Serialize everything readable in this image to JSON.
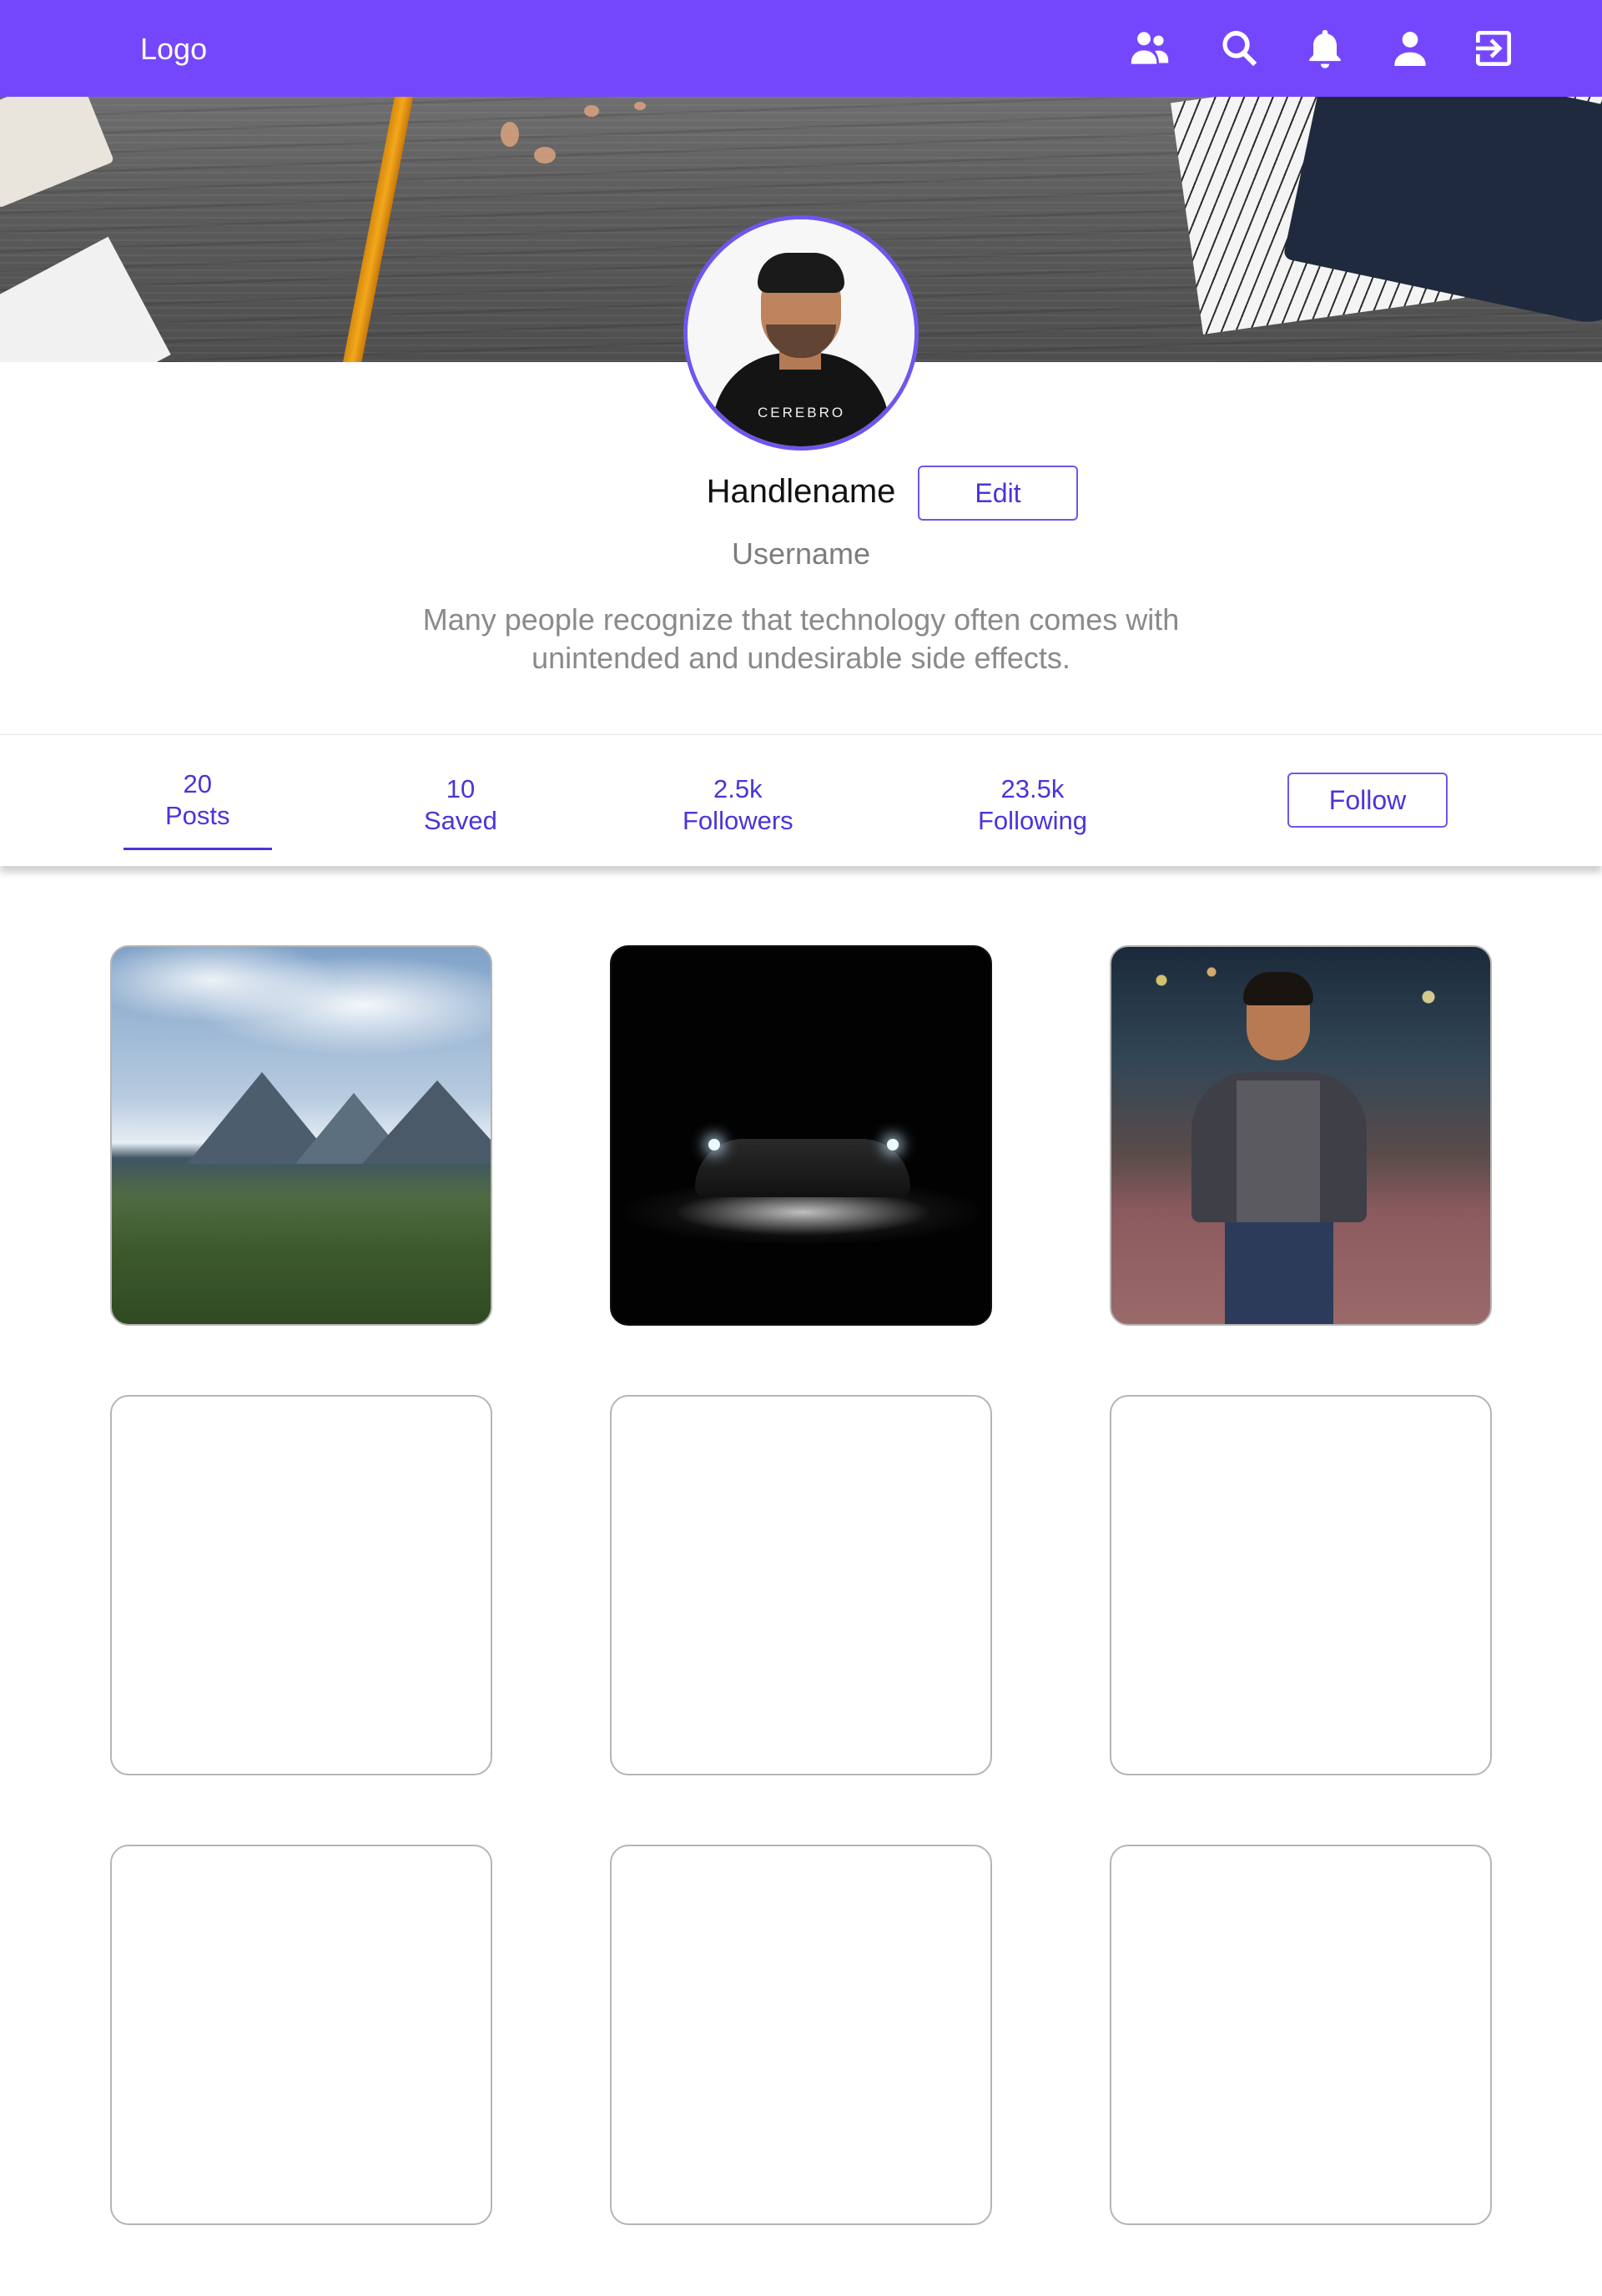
{
  "navbar": {
    "logo": "Logo",
    "background": "#7547fc",
    "icons": [
      "people-icon",
      "search-icon",
      "bell-icon",
      "profile-icon",
      "logout-icon"
    ]
  },
  "profile": {
    "handlename": "Handlename",
    "edit_label": "Edit",
    "username": "Username",
    "bio": "Many people recognize that technology often comes with unintended and undesirable side effects.",
    "avatar_tee_text": "CEREBRO"
  },
  "stats": {
    "posts": {
      "count": "20",
      "label": "Posts"
    },
    "saved": {
      "count": "10",
      "label": "Saved"
    },
    "followers": {
      "count": "2.5k",
      "label": "Followers"
    },
    "following": {
      "count": "23.5k",
      "label": "Following"
    },
    "follow_label": "Follow",
    "active_tab": "posts"
  },
  "grid": {
    "posts": [
      {
        "content": "mountain landscape photo"
      },
      {
        "content": "dark car with headlights photo"
      },
      {
        "content": "man standing on street at night photo"
      },
      {
        "content": "empty"
      },
      {
        "content": "empty"
      },
      {
        "content": "empty"
      },
      {
        "content": "empty"
      },
      {
        "content": "empty"
      },
      {
        "content": "empty"
      }
    ]
  },
  "colors": {
    "accent": "#7547fc",
    "link": "#4a35d8",
    "border": "#6e56ee"
  }
}
